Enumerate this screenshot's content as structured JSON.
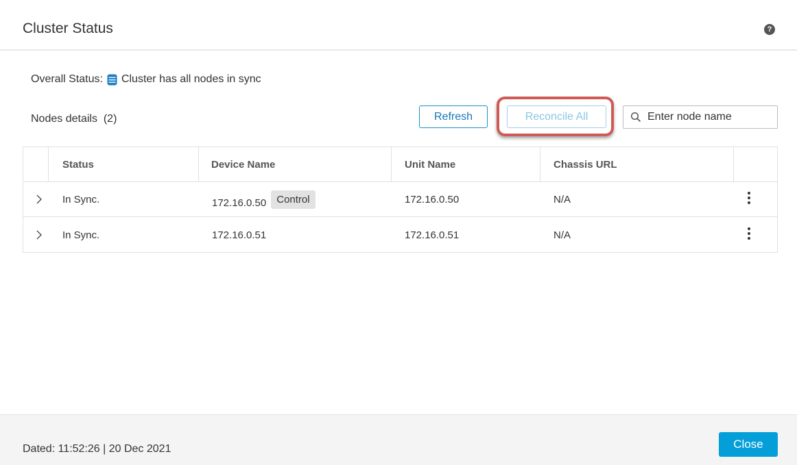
{
  "dialog": {
    "title": "Cluster Status",
    "help_icon": "question-circle-icon"
  },
  "overall": {
    "label": "Overall Status:",
    "status_icon": "database-icon",
    "status_icon_color": "#1b7ec6",
    "status_text": "Cluster has all nodes in sync"
  },
  "nodes": {
    "label": "Nodes details",
    "count": "(2)"
  },
  "toolbar": {
    "refresh_label": "Refresh",
    "reconcile_label": "Reconcile All",
    "reconcile_highlight_color": "#cf5a56",
    "search_placeholder": "Enter node name"
  },
  "table": {
    "columns": [
      "Status",
      "Device Name",
      "Unit Name",
      "Chassis URL"
    ],
    "rows": [
      {
        "status": "In Sync.",
        "device_name": "172.16.0.50",
        "badge": "Control",
        "unit_name": "172.16.0.50",
        "chassis_url": "N/A"
      },
      {
        "status": "In Sync.",
        "device_name": "172.16.0.51",
        "badge": "",
        "unit_name": "172.16.0.51",
        "chassis_url": "N/A"
      }
    ]
  },
  "footer": {
    "dated": "Dated: 11:52:26 | 20 Dec 2021",
    "close_label": "Close",
    "close_color": "#049fd9"
  }
}
